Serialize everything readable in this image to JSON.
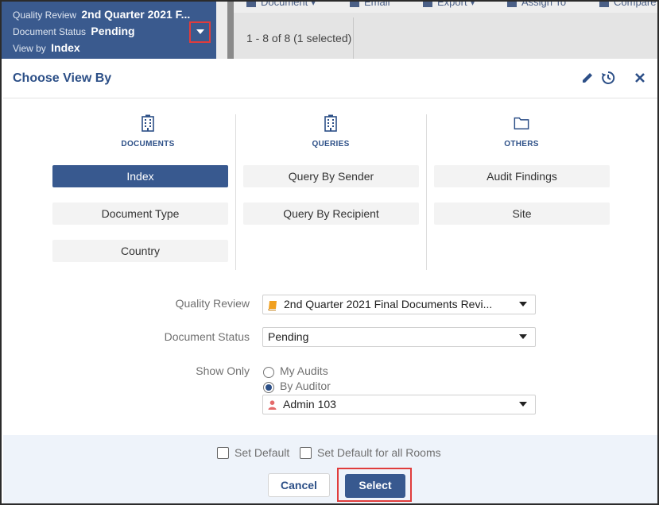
{
  "summary": {
    "rows": [
      {
        "label": "Quality Review",
        "value": "2nd Quarter 2021 F..."
      },
      {
        "label": "Document Status",
        "value": "Pending"
      },
      {
        "label": "View by",
        "value": "Index"
      }
    ]
  },
  "toolbar": {
    "items": [
      "Document",
      "Email",
      "Export",
      "Assign To",
      "Compare"
    ]
  },
  "record_count": "1 - 8 of 8 (1 selected)",
  "modal": {
    "title": "Choose View By",
    "columns": [
      {
        "title": "DOCUMENTS",
        "icon": "building-icon",
        "options": [
          "Index",
          "Document Type",
          "Country"
        ]
      },
      {
        "title": "QUERIES",
        "icon": "building-icon",
        "options": [
          "Query By Sender",
          "Query By Recipient"
        ]
      },
      {
        "title": "OTHERS",
        "icon": "folder-icon",
        "options": [
          "Audit Findings",
          "Site"
        ]
      }
    ],
    "selected_option": "Index",
    "form": {
      "quality_review_label": "Quality Review",
      "quality_review_value": "2nd Quarter 2021 Final Documents Revi...",
      "document_status_label": "Document Status",
      "document_status_value": "Pending",
      "show_only_label": "Show Only",
      "radio_my_audits": "My Audits",
      "radio_by_auditor": "By Auditor",
      "auditor_value": "Admin 103"
    },
    "footer": {
      "set_default": "Set Default",
      "set_default_all": "Set Default for all Rooms",
      "cancel": "Cancel",
      "select": "Select"
    }
  },
  "colors": {
    "primary": "#38598f",
    "title": "#2c4f87",
    "highlight_border": "#e03c3c",
    "footer_bg": "#eef3fa",
    "book_icon": "#f0a020",
    "user_icon": "#e46a6a"
  }
}
